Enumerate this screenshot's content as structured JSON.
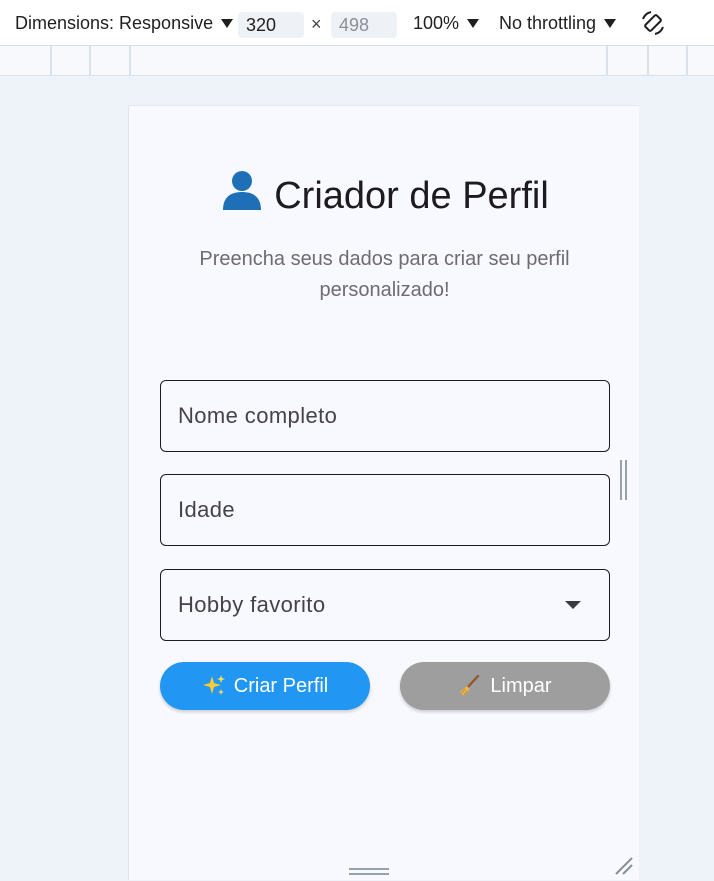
{
  "devtools": {
    "dimensions_label": "Dimensions: Responsive",
    "width_value": "320",
    "times_sign": "×",
    "height_value": "498",
    "zoom_label": "100%",
    "throttling_label": "No throttling",
    "rotate_icon": "rotate-icon"
  },
  "page": {
    "title_icon": "👤",
    "title": "Criador de Perfil",
    "subtitle": "Preencha seus dados para criar seu perfil personalizado!",
    "fields": {
      "name_label": "Nome completo",
      "age_label": "Idade",
      "hobby_label": "Hobby favorito"
    },
    "buttons": {
      "create_icon": "✨",
      "create_label": "Criar Perfil",
      "clear_icon": "🧹",
      "clear_label": "Limpar"
    }
  },
  "colors": {
    "primary": "#2196f3",
    "secondary": "#9e9e9e",
    "text": "#1d1b20",
    "muted": "#6f6a73"
  }
}
